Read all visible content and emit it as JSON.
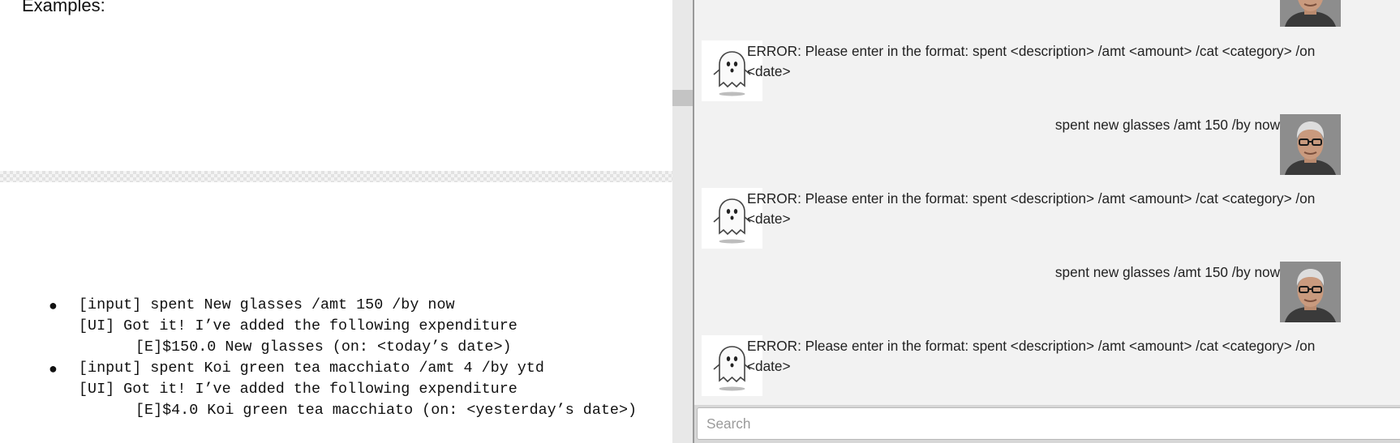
{
  "document": {
    "heading": "Examples:",
    "examples": [
      {
        "input": "[input] spent New glasses /amt 150 /by now",
        "response": "[UI] Got it! I’ve added the following expenditure",
        "entry": "[E]$150.0 New glasses (on: <today’s date>)"
      },
      {
        "input": "[input] spent Koi green tea macchiato /amt 4 /by ytd",
        "response": "[UI] Got it! I’ve added the following expenditure",
        "entry": "[E]$4.0 Koi green tea macchiato (on: <yesterday’s date>)"
      }
    ]
  },
  "chat": {
    "messages": [
      {
        "sender": "user",
        "text": "",
        "avatar_icon": "user-photo-icon"
      },
      {
        "sender": "bot",
        "text": "ERROR: Please enter in the format: spent <description> /amt <amount> /cat <category> /on <date>",
        "avatar_icon": "ghost-icon"
      },
      {
        "sender": "user",
        "text": "spent new glasses /amt 150 /by now",
        "avatar_icon": "user-photo-icon"
      },
      {
        "sender": "bot",
        "text": "ERROR: Please enter in the format: spent <description> /amt <amount> /cat <category> /on <date>",
        "avatar_icon": "ghost-icon"
      },
      {
        "sender": "user",
        "text": "spent new glasses /amt 150 /by now",
        "avatar_icon": "user-photo-icon"
      },
      {
        "sender": "bot",
        "text": "ERROR: Please enter in the format: spent <description> /amt <amount> /cat <category> /on <date>",
        "avatar_icon": "ghost-icon"
      }
    ],
    "input": {
      "placeholder": "Search",
      "value": ""
    }
  },
  "colors": {
    "chat_background": "#f2f2f2",
    "divider": "#e8e8e8",
    "input_border": "#b9b9b9"
  }
}
